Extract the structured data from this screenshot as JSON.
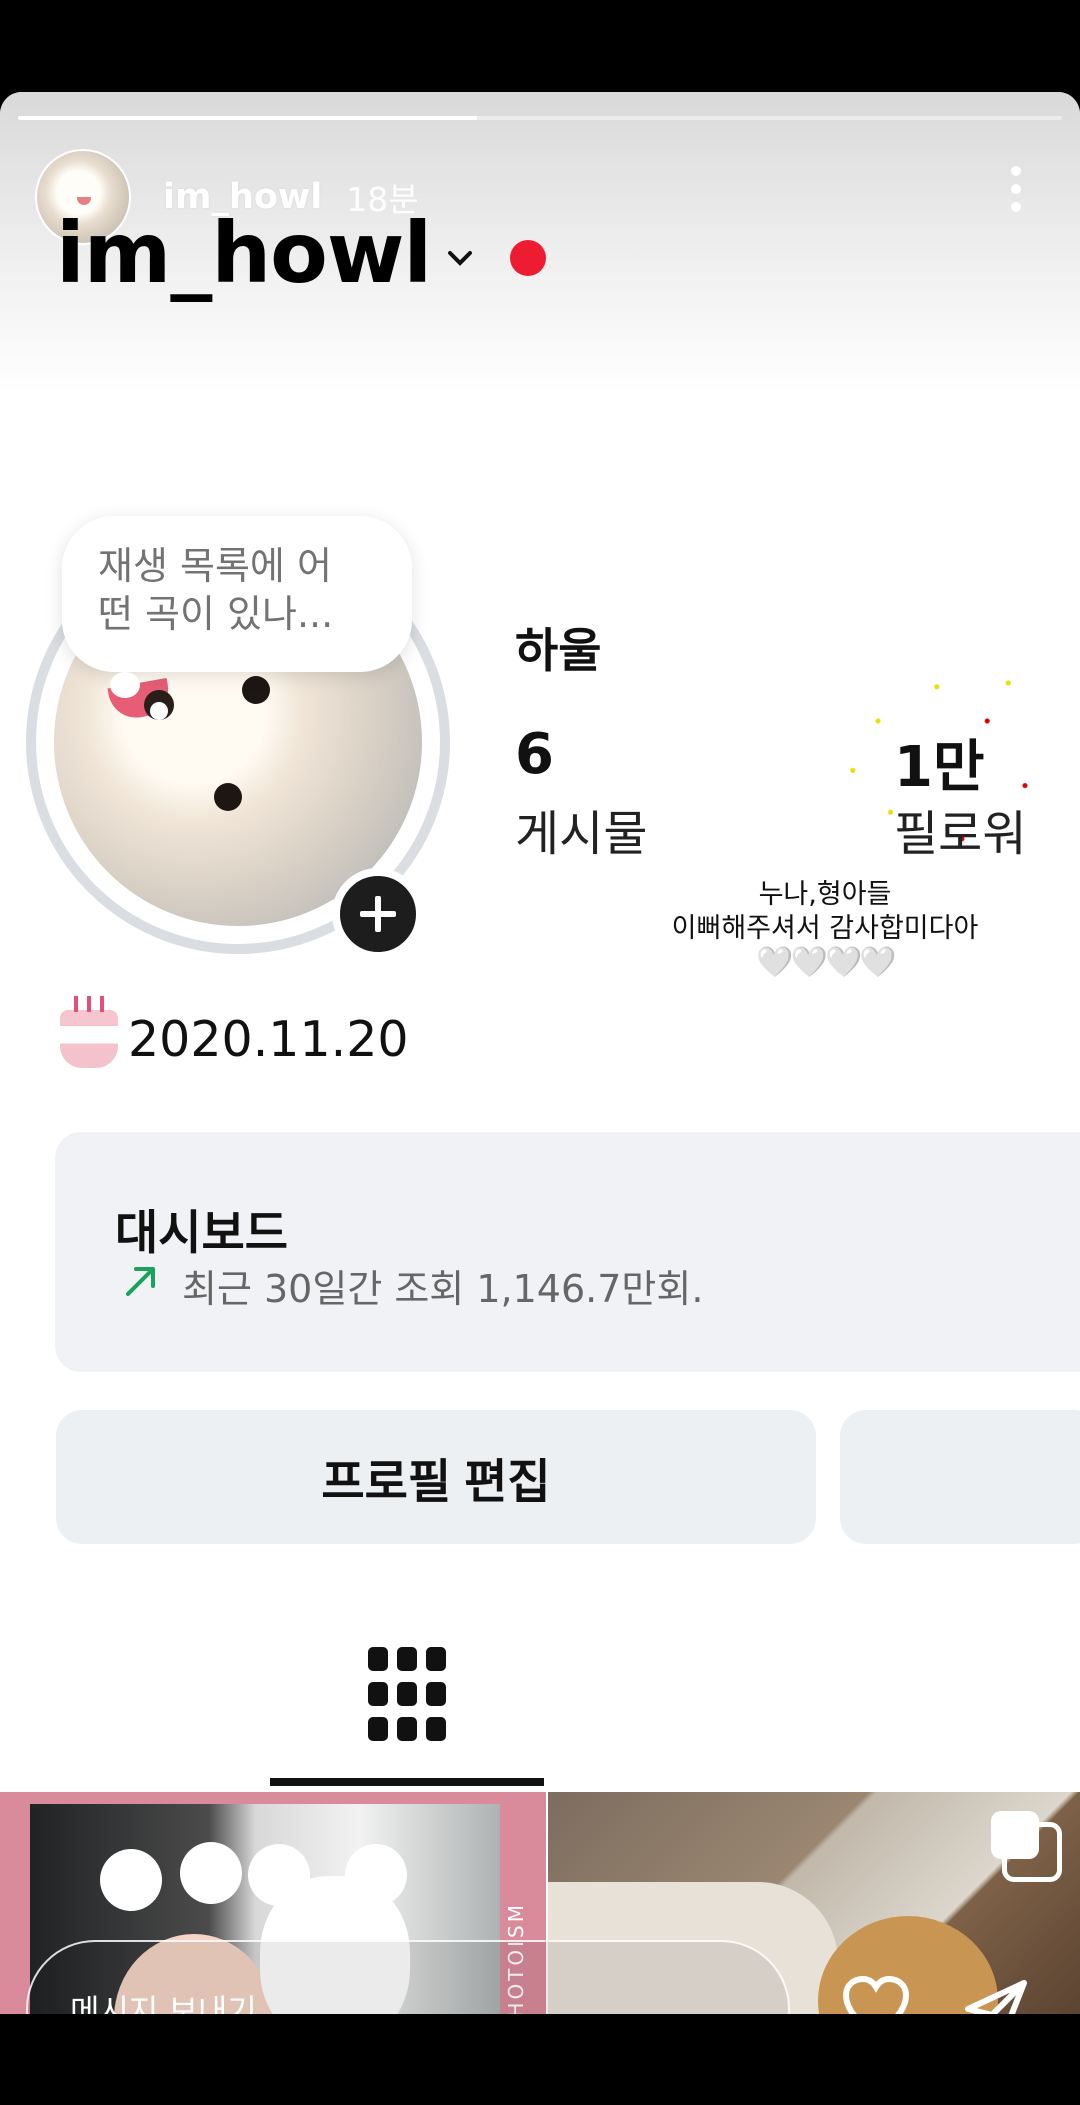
{
  "story": {
    "username": "im_howl",
    "time": "18분",
    "progress": 0.44
  },
  "profile": {
    "handle": "im_howl",
    "display_name": "하울",
    "posts_count": "6",
    "posts_label": "게시물",
    "followers_count": "1만",
    "followers_label": "필로워",
    "playlist_bubble": "재생 목록에 어 떤 곡이 있나...",
    "birthday": "2020.11.20"
  },
  "overlay_text": {
    "thanks_line1": "누나,형아들",
    "thanks_line2": "이뻐해주셔서 감사합미다아",
    "hearts": "🤍🤍🤍🤍"
  },
  "dashboard": {
    "title": "대시보드",
    "description": "최근 30일간 조회 1,146.7만회."
  },
  "actions": {
    "edit_profile": "프로필 편집"
  },
  "thumbnail": {
    "photo_text": "PHOTOISM"
  },
  "message": {
    "placeholder": "메시지 보내기"
  },
  "colors": {
    "accent_red": "#ee1c33",
    "trend_green": "#18a35a"
  },
  "icons": [
    "more-icon",
    "chevron-down-icon",
    "plus-icon",
    "cake-icon",
    "trend-up-icon",
    "grid-icon",
    "multiple-photos-icon",
    "heart-icon",
    "send-icon"
  ]
}
